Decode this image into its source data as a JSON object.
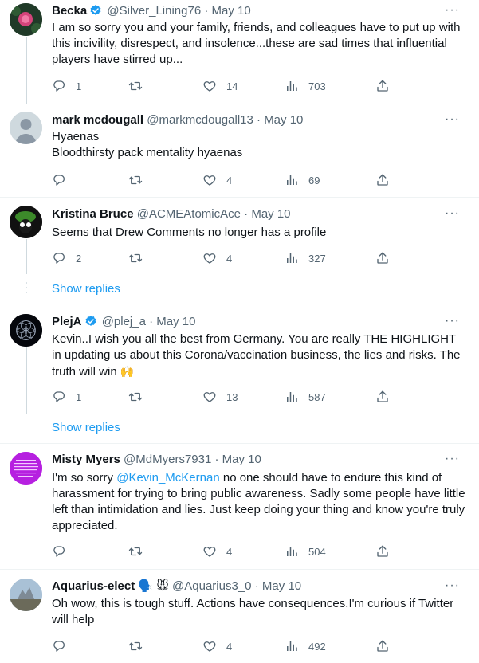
{
  "tweets": [
    {
      "name": "Becka",
      "handle": "@Silver_Lining76",
      "sep": "·",
      "date": "May 10",
      "text": "I am so sorry you and your family, friends, and colleagues have to put up with this incivility, disrespect, and insolence...these are sad times that influential players have stirred up...",
      "replies": "1",
      "retweets": "",
      "likes": "14",
      "views": "703"
    },
    {
      "name": "mark mcdougall",
      "handle": "@markmcdougall13",
      "sep": "·",
      "date": "May 10",
      "text_line1": "Hyaenas",
      "text_line2": "Bloodthirsty pack mentality hyaenas",
      "replies": "",
      "retweets": "",
      "likes": "4",
      "views": "69"
    },
    {
      "name": "Kristina Bruce",
      "handle": "@ACMEAtomicAce",
      "sep": "·",
      "date": "May 10",
      "text": "Seems that Drew Comments no longer has a profile",
      "replies": "2",
      "retweets": "",
      "likes": "4",
      "views": "327",
      "show_replies": "Show replies"
    },
    {
      "name": "PlejA",
      "handle": "@plej_a",
      "sep": "·",
      "date": "May 10",
      "text": "Kevin..I wish you all the best from Germany. You are really THE HIGHLIGHT in updating us about this Corona/vaccination business, the lies and risks. The truth will win",
      "emoji": "🙌",
      "replies": "1",
      "retweets": "",
      "likes": "13",
      "views": "587",
      "show_replies": "Show replies"
    },
    {
      "name": "Misty Myers",
      "handle": "@MdMyers7931",
      "sep": "·",
      "date": "May 10",
      "text_before": "I'm so sorry ",
      "mention": "@Kevin_McKernan",
      "text_after": " no one should have to endure this kind of harassment for trying to bring public awareness. Sadly some people have little left than intimidation and lies. Just keep doing your thing and know you're truly appreciated.",
      "replies": "",
      "retweets": "",
      "likes": "4",
      "views": "504"
    },
    {
      "name": "Aquarius-elect",
      "name_emojis": "🗣️ 🐭",
      "handle": "@Aquarius3_0",
      "sep": "·",
      "date": "May 10",
      "text": "Oh wow, this is tough stuff. Actions have consequences.I'm curious if Twitter will help",
      "replies": "",
      "retweets": "",
      "likes": "4",
      "views": "492"
    }
  ],
  "more_glyph": "···",
  "colors": {
    "accent": "#1d9bf0",
    "muted": "#536471",
    "text": "#0f1419",
    "divider": "#eff3f4",
    "thread_line": "#cfd9de",
    "misty_avatar": "#b620e0"
  },
  "icons": [
    "reply-icon",
    "retweet-icon",
    "like-icon",
    "views-icon",
    "share-icon",
    "more-icon",
    "verified-icon"
  ]
}
